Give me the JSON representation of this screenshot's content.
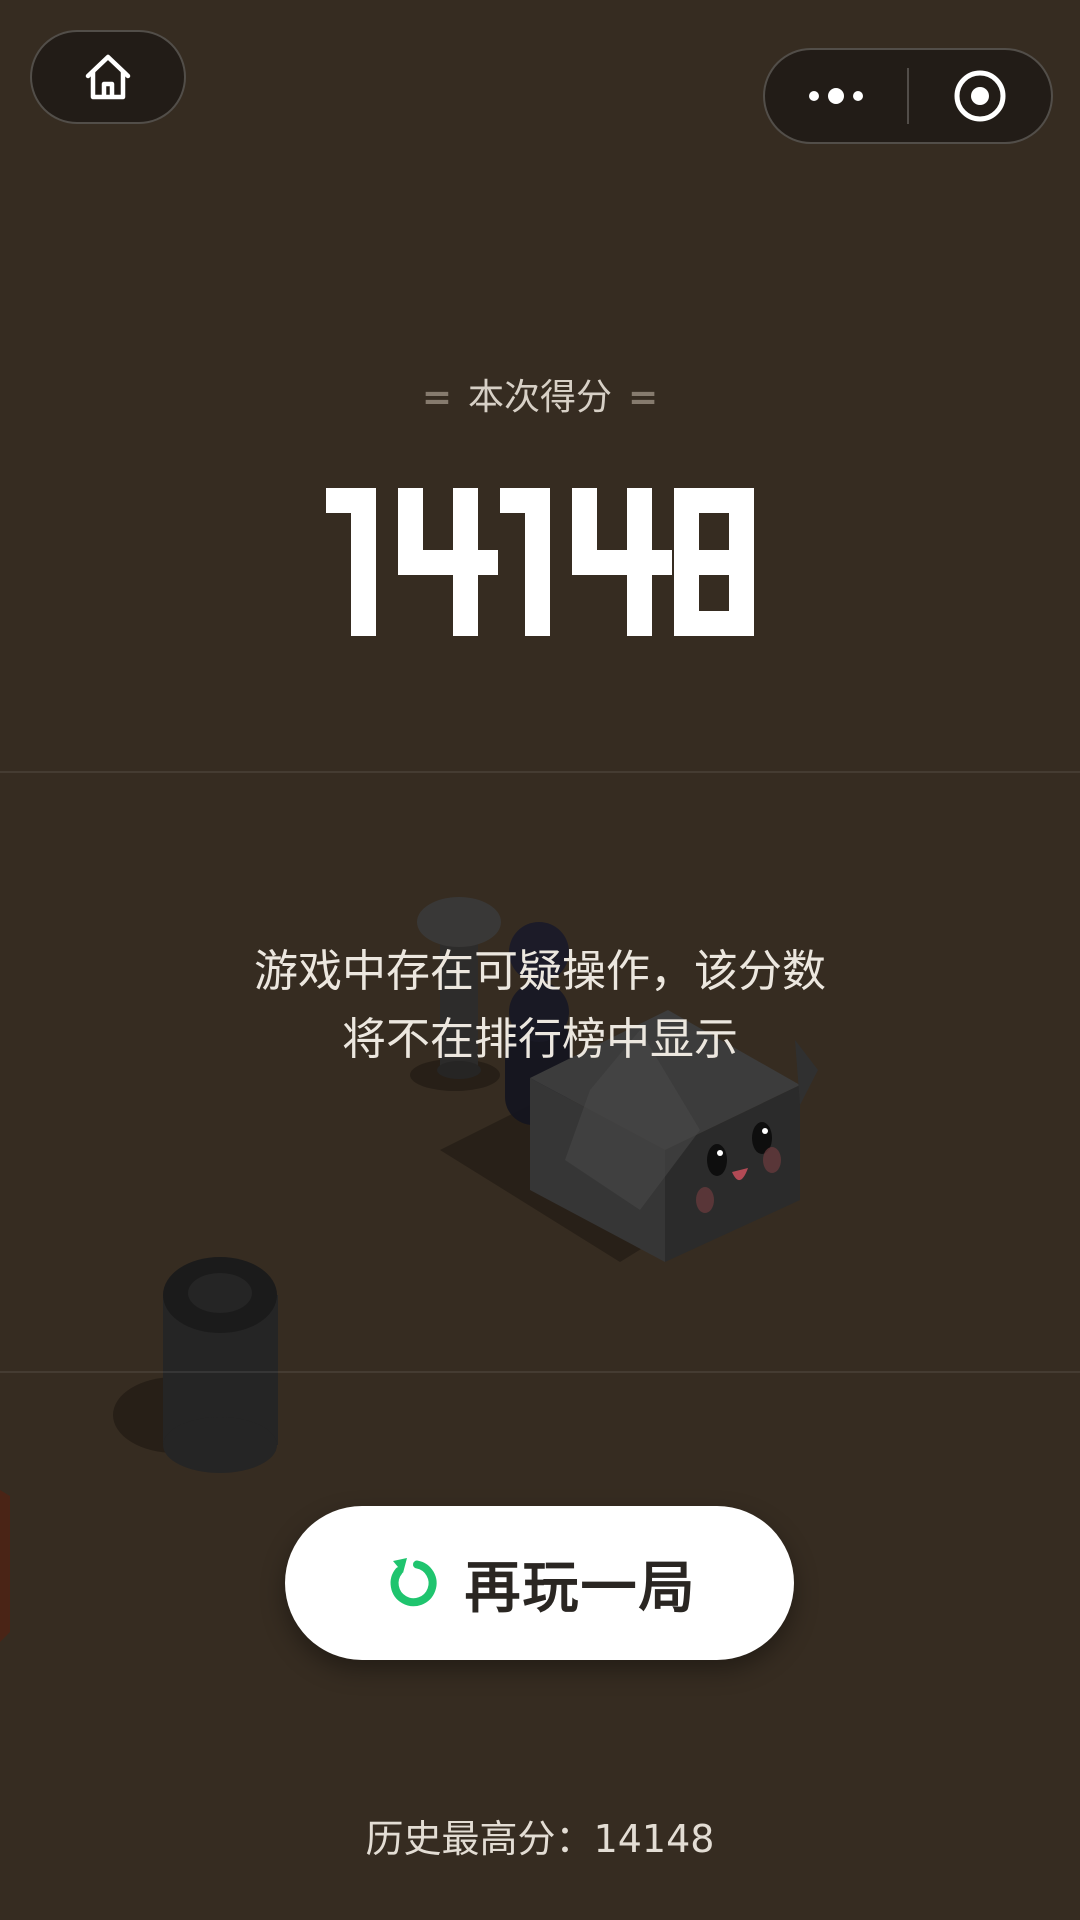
{
  "nav": {
    "home_icon": "home-icon",
    "more_icon": "more-dots-icon",
    "close_icon": "target-close-icon"
  },
  "score": {
    "label": "本次得分",
    "value": "14148"
  },
  "warning": {
    "line1": "游戏中存在可疑操作，该分数",
    "line2": "将不在排行榜中显示"
  },
  "replay": {
    "label": "再玩一局",
    "icon": "refresh-icon",
    "icon_color": "#1fc46e"
  },
  "best": {
    "label": "历史最高分：",
    "value": "14148"
  },
  "colors": {
    "background": "#362c21",
    "accent": "#1fc46e"
  }
}
